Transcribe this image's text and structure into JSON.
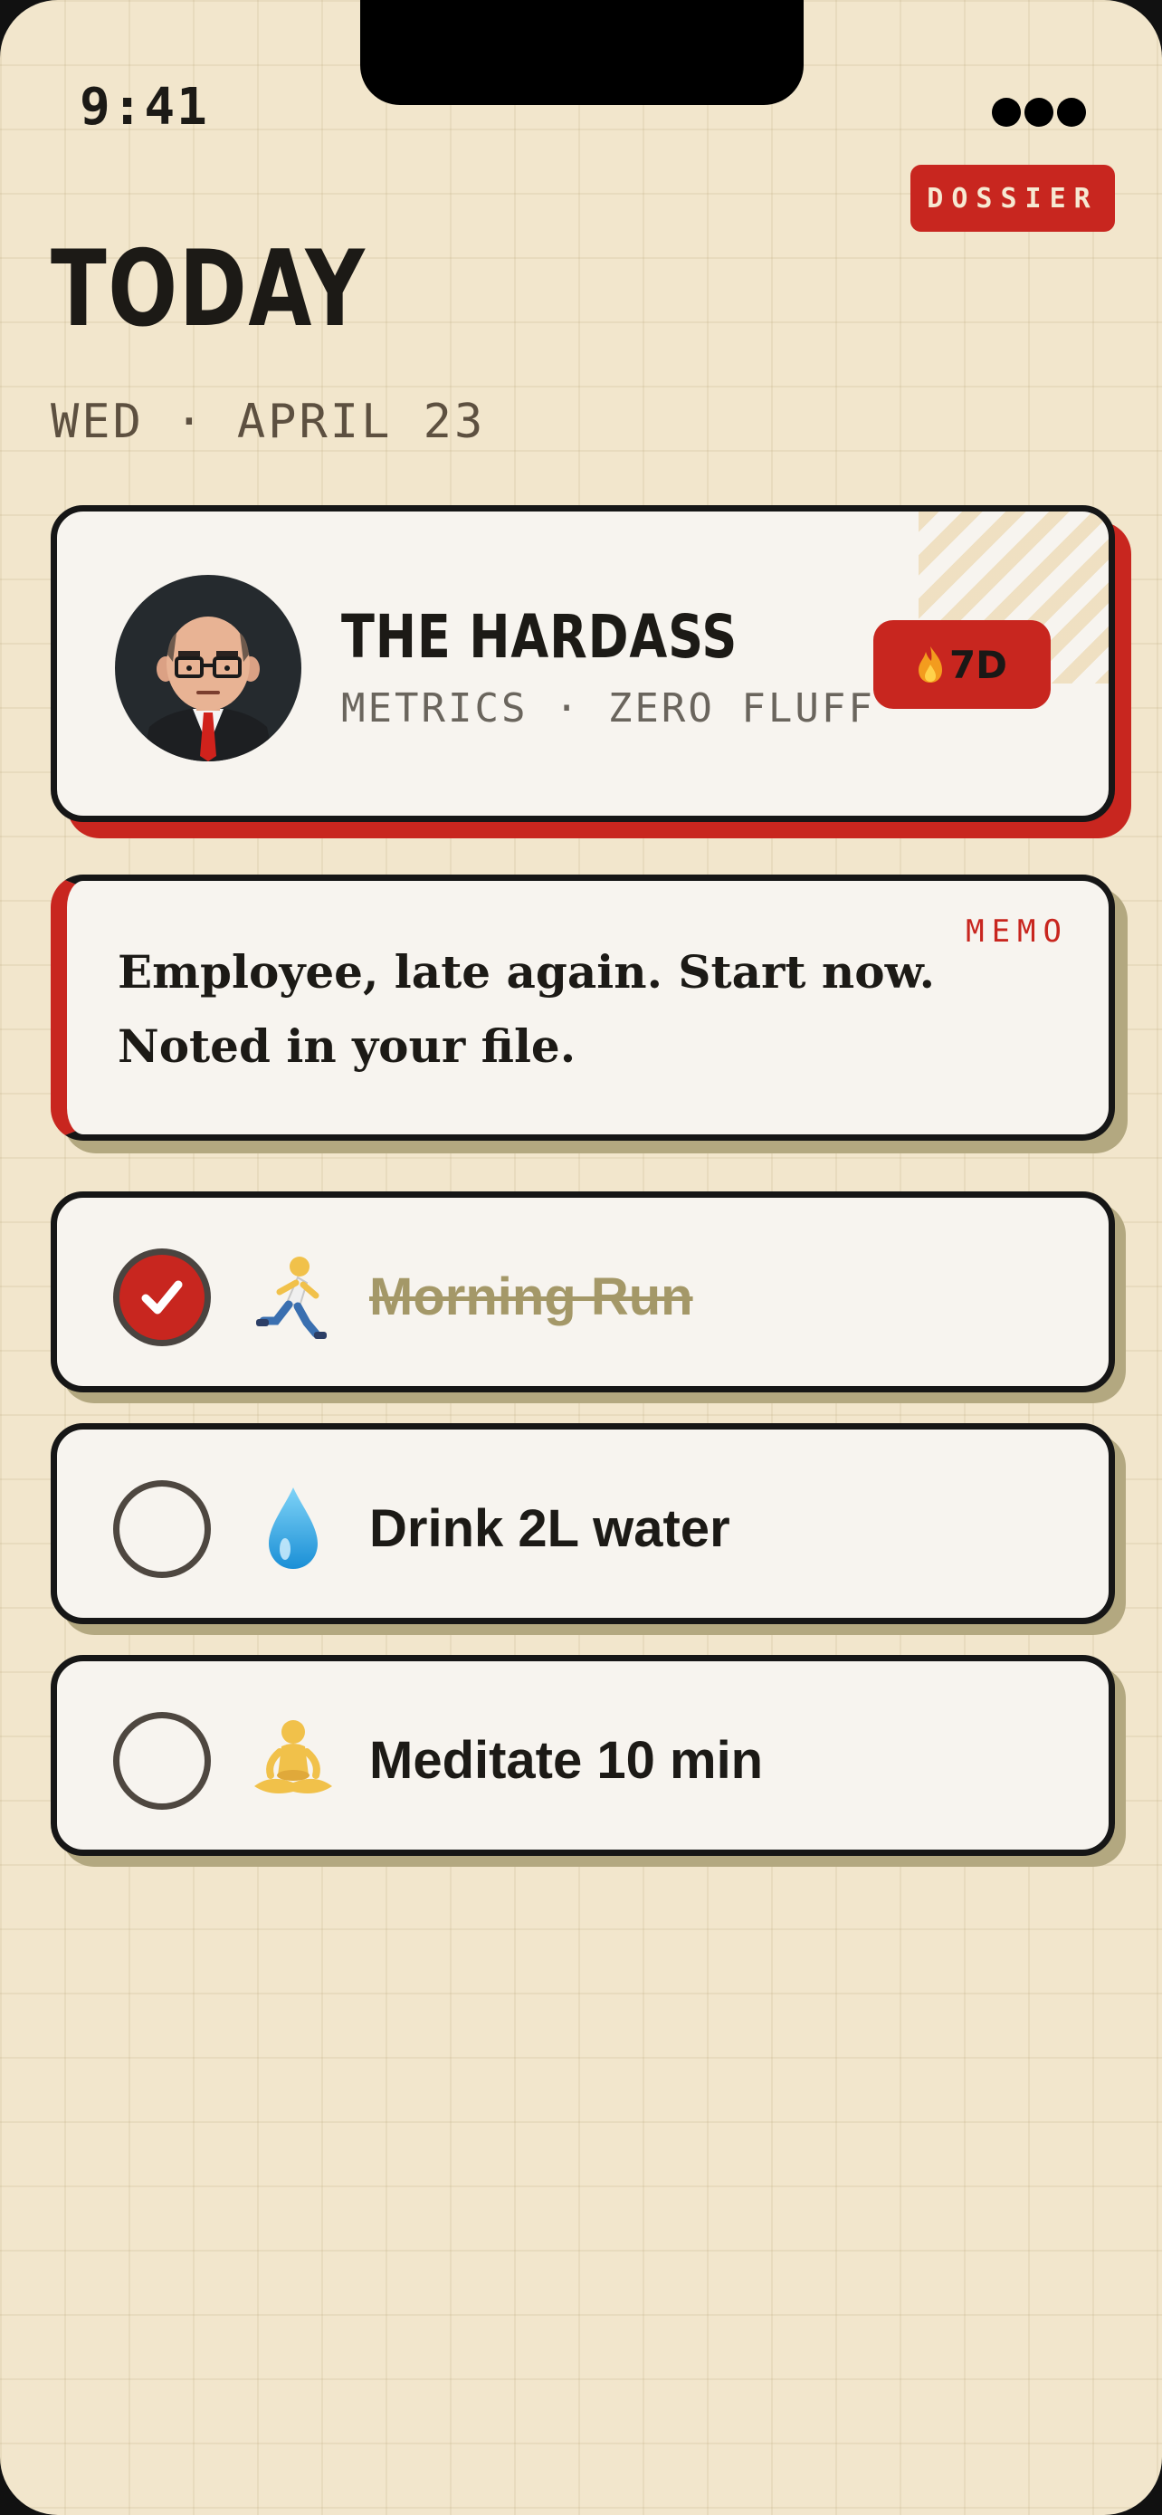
{
  "status_bar": {
    "time": "9:41"
  },
  "header": {
    "dossier_label": "DOSSIER",
    "title": "TODAY",
    "date": "WED · APRIL 23"
  },
  "coach": {
    "name": "THE HARDASS",
    "tagline": "METRICS · ZERO FLUFF",
    "streak": "7D",
    "avatar_icon": "businessman-avatar-icon",
    "streak_icon": "flame-icon"
  },
  "memo": {
    "label": "MEMO",
    "text": "Employee, late again. Start now. Noted in your file."
  },
  "tasks": [
    {
      "label": "Morning Run",
      "done": true,
      "icon": "runner-icon"
    },
    {
      "label": "Drink 2L water",
      "done": false,
      "icon": "water-drop-icon"
    },
    {
      "label": "Meditate 10 min",
      "done": false,
      "icon": "meditation-icon"
    }
  ],
  "colors": {
    "background": "#f2e6cc",
    "accent": "#c8261f",
    "card": "#f7f4ef",
    "ink": "#1c1a16",
    "done_text": "#a49868"
  }
}
